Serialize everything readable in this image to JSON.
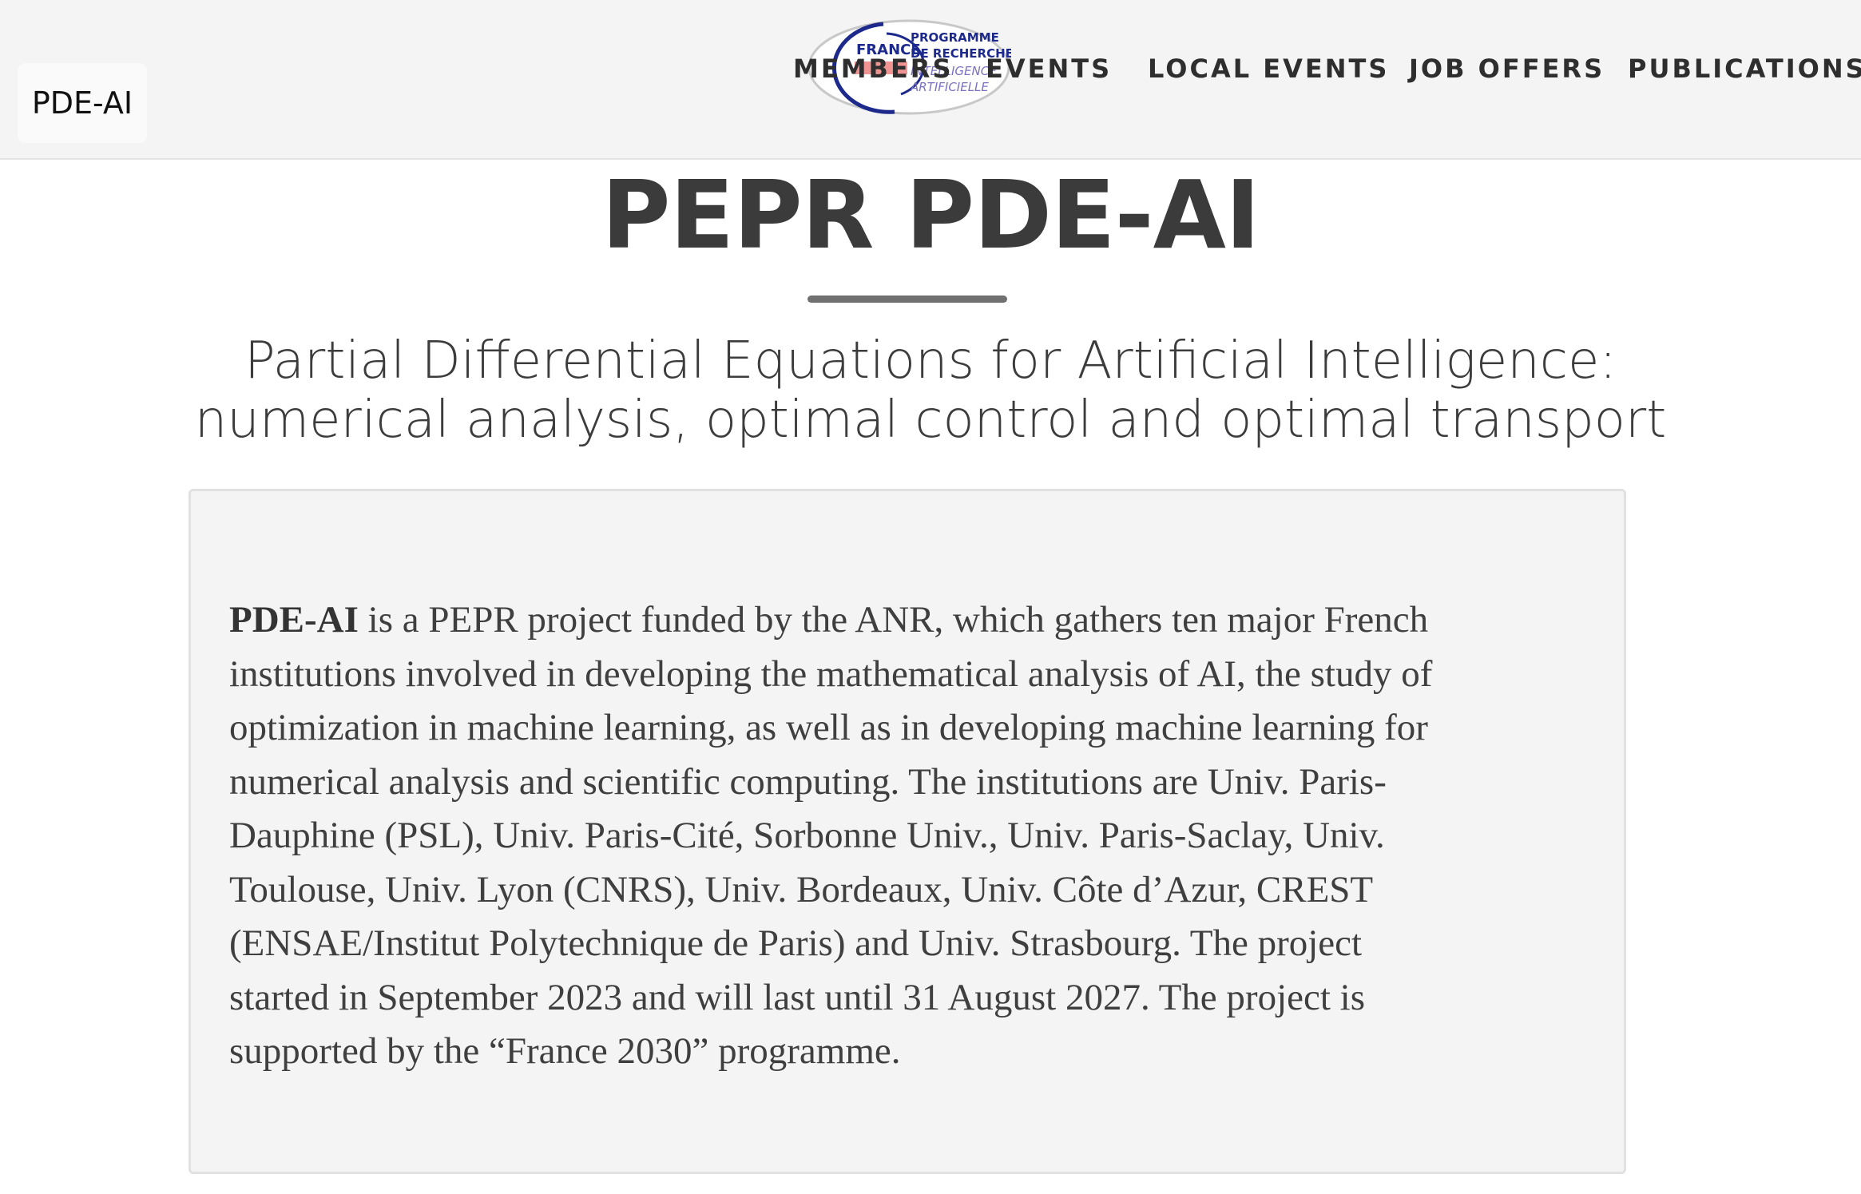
{
  "header": {
    "brand": "PDE-AI",
    "nav": [
      {
        "label": "MEMBERS"
      },
      {
        "label": "EVENTS"
      },
      {
        "label": "LOCAL EVENTS"
      },
      {
        "label": "JOB OFFERS"
      },
      {
        "label": "PUBLICATIONS"
      }
    ],
    "logo": {
      "country": "FRANCE",
      "line1": "PROGRAMME",
      "line2": "DE RECHERCHE",
      "line3": "INTELLIGENCE",
      "line4": "ARTIFICIELLE",
      "colors": {
        "navy": "#1d2a8c",
        "red": "#e23a3a",
        "purple": "#7a72c0"
      }
    }
  },
  "hero": {
    "title": "PEPR PDE-AI",
    "subtitle_line1": "Partial Differential Equations for Artificial Intelligence:",
    "subtitle_line2": "numerical analysis, optimal control and optimal transport"
  },
  "intro": {
    "bold_lead": "PDE-AI",
    "lines": [
      " is a PEPR project funded by the ANR, which gathers ten major French",
      "institutions involved in developing the mathematical analysis of AI, the study of",
      "optimization in machine learning, as well as in developing machine learning for",
      "numerical analysis and scientific computing. The institutions are Univ. Paris-",
      "Dauphine (PSL), Univ. Paris-Cité, Sorbonne Univ., Univ. Paris-Saclay, Univ.",
      "Toulouse, Univ. Lyon (CNRS), Univ. Bordeaux, Univ. Côte d’Azur, CREST",
      "(ENSAE/Institut Polytechnique de Paris) and Univ. Strasbourg. The project",
      "started in September 2023 and will last until 31 August 2027. The project is",
      "supported by the “France 2030” programme."
    ]
  }
}
